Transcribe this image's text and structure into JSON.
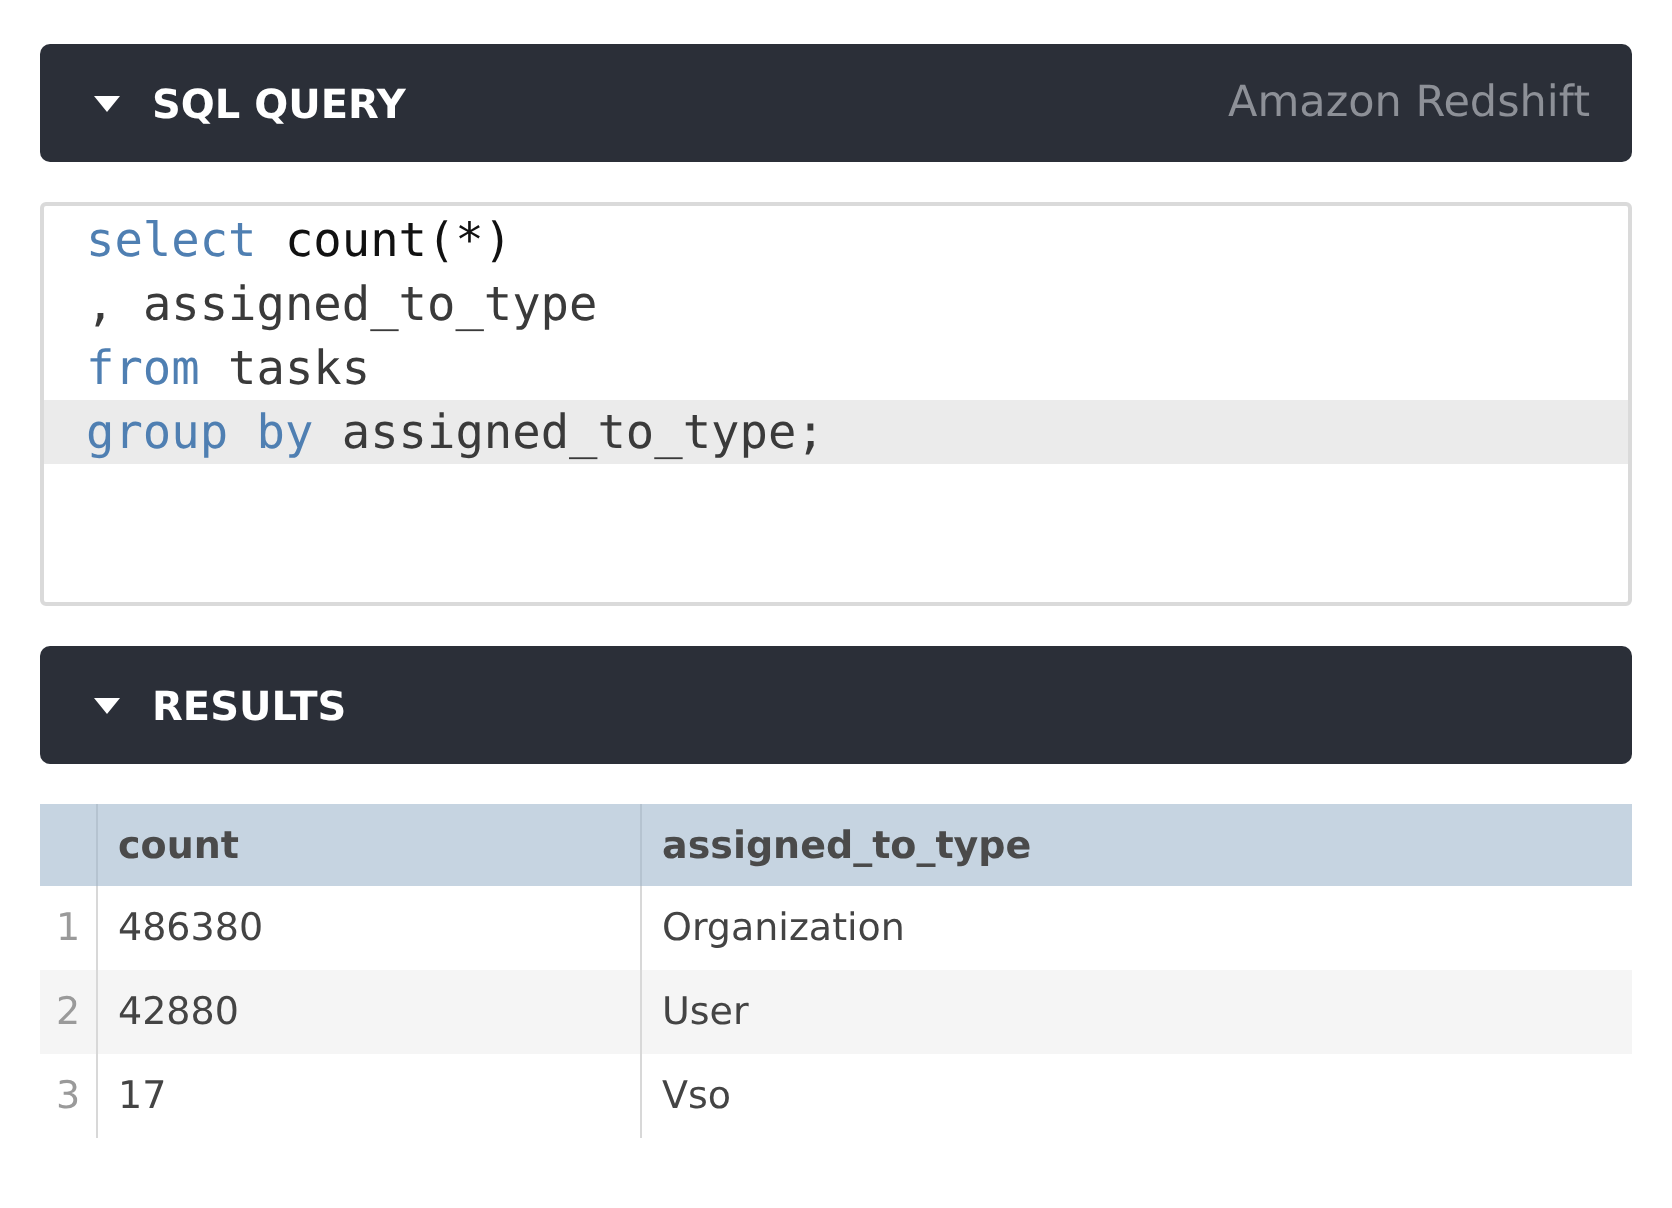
{
  "query_panel": {
    "title": "SQL QUERY",
    "source": "Amazon Redshift",
    "expanded": true,
    "editor": {
      "lines": [
        {
          "active": false,
          "tokens": [
            {
              "kind": "keyword",
              "text": "select"
            },
            {
              "kind": "function",
              "text": "count(*)"
            }
          ]
        },
        {
          "active": false,
          "tokens": [
            {
              "kind": "plain",
              "text": ","
            },
            {
              "kind": "plain",
              "text": "assigned_to_type"
            }
          ]
        },
        {
          "active": false,
          "tokens": [
            {
              "kind": "keyword",
              "text": "from"
            },
            {
              "kind": "plain",
              "text": "tasks"
            }
          ]
        },
        {
          "active": true,
          "tokens": [
            {
              "kind": "keyword",
              "text": "group"
            },
            {
              "kind": "keyword",
              "text": "by"
            },
            {
              "kind": "plain",
              "text": "assigned_to_type;"
            }
          ]
        }
      ]
    }
  },
  "results_panel": {
    "title": "RESULTS",
    "expanded": true,
    "table": {
      "columns": [
        "count",
        "assigned_to_type"
      ],
      "rows": [
        {
          "number": "1",
          "cells": [
            "486380",
            "Organization"
          ]
        },
        {
          "number": "2",
          "cells": [
            "42880",
            "User"
          ]
        },
        {
          "number": "3",
          "cells": [
            "17",
            "Vso"
          ]
        }
      ]
    }
  }
}
